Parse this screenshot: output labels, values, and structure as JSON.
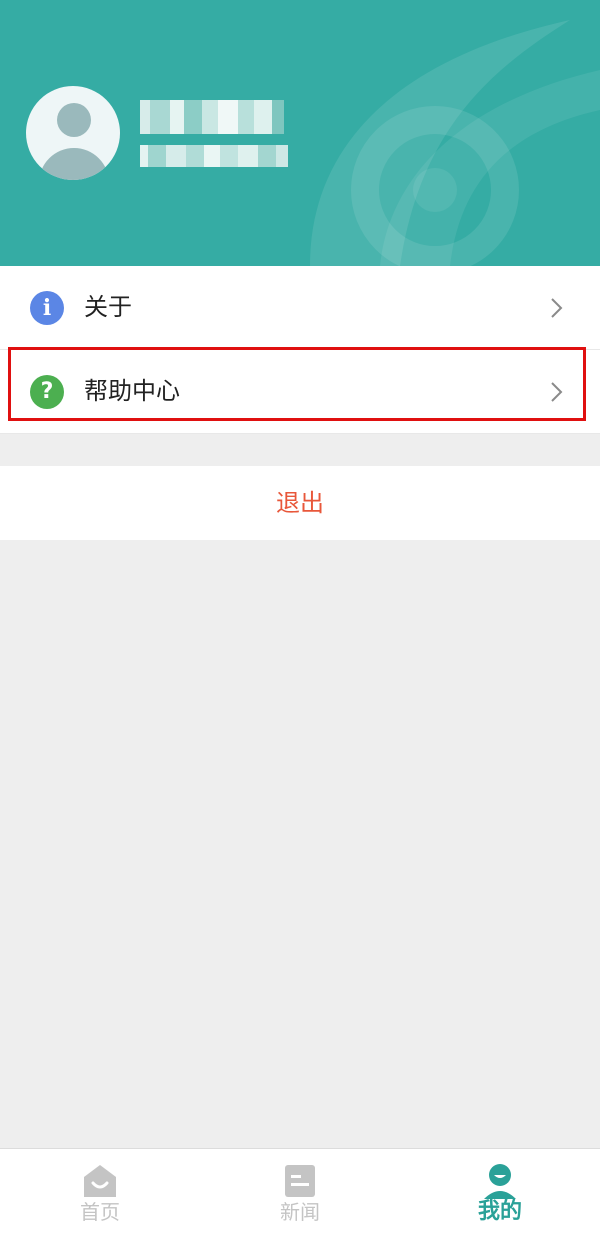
{
  "profile": {
    "avatar_icon": "default-avatar-icon",
    "name_hidden": "pixelated",
    "phone_hidden": "pixelated"
  },
  "menu": [
    {
      "label": "关于",
      "icon": "info-icon",
      "icon_glyph": "i",
      "icon_color": "#5b86e5"
    },
    {
      "label": "帮助中心",
      "icon": "help-icon",
      "icon_glyph": "?",
      "icon_color": "#4caf50"
    }
  ],
  "logout": {
    "label": "退出",
    "color": "#e8573a"
  },
  "tabbar": {
    "tabs": [
      {
        "label": "首页",
        "icon": "home-icon",
        "active": false
      },
      {
        "label": "新闻",
        "icon": "news-icon",
        "active": false
      },
      {
        "label": "我的",
        "icon": "profile-icon",
        "active": true
      }
    ],
    "active_color": "#2aa198",
    "inactive_color": "#c4c4c4"
  },
  "colors": {
    "header": "#35aca4",
    "highlight": "#e01010"
  }
}
